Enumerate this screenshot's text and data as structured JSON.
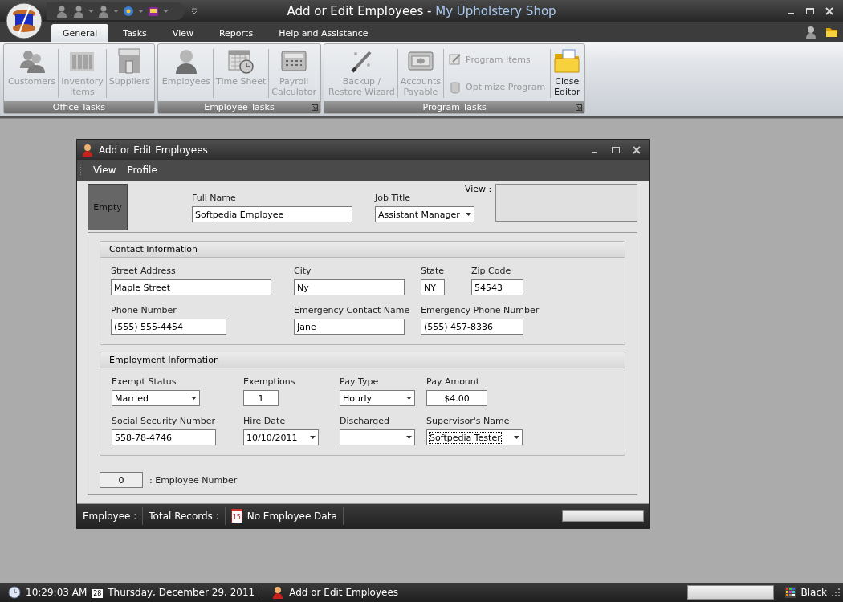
{
  "app": {
    "title": "Add or Edit Employees -",
    "app_name": "My Upholstery Shop"
  },
  "tabs": [
    {
      "label": "General",
      "selected": true
    },
    {
      "label": "Tasks",
      "selected": false
    },
    {
      "label": "View",
      "selected": false
    },
    {
      "label": "Reports",
      "selected": false
    },
    {
      "label": "Help and Assistance",
      "selected": false
    }
  ],
  "ribbon": {
    "groups": [
      {
        "label": "Office Tasks",
        "has_launcher": false,
        "items": [
          {
            "kind": "large",
            "label": "Customers",
            "disabled": true
          },
          {
            "kind": "large",
            "label": "Inventory\nItems",
            "disabled": true
          },
          {
            "kind": "large",
            "label": "Suppliers",
            "disabled": true
          }
        ]
      },
      {
        "label": "Employee Tasks",
        "has_launcher": true,
        "items": [
          {
            "kind": "large",
            "label": "Employees",
            "disabled": true
          },
          {
            "kind": "large",
            "label": "Time Sheet",
            "disabled": true
          },
          {
            "kind": "large",
            "label": "Payroll\nCalculator",
            "disabled": true
          }
        ]
      },
      {
        "label": "Program Tasks",
        "has_launcher": true,
        "items": [
          {
            "kind": "large",
            "label": "Backup /\nRestore Wizard",
            "disabled": true
          },
          {
            "kind": "large",
            "label": "Accounts\nPayable",
            "disabled": true
          },
          {
            "kind": "small",
            "label": "Program Items",
            "disabled": true
          },
          {
            "kind": "small",
            "label": "Optimize Program",
            "disabled": true
          },
          {
            "kind": "large",
            "label": "Close\nEditor",
            "disabled": false
          }
        ]
      }
    ]
  },
  "dialog": {
    "title": "Add or Edit Employees",
    "menu": [
      "View",
      "Profile"
    ],
    "photo_text": "Empty",
    "full_name": {
      "label": "Full Name",
      "value": "Softpedia Employee"
    },
    "job_title": {
      "label": "Job Title",
      "value": "Assistant Manager"
    },
    "view_label": "View :",
    "sections": [
      {
        "title": "Contact Information",
        "fields": [
          {
            "label": "Street Address",
            "value": "Maple Street",
            "kind": "text",
            "focused": false
          },
          {
            "label": "City",
            "value": "Ny",
            "kind": "text",
            "focused": false
          },
          {
            "label": "State",
            "value": "NY",
            "kind": "text",
            "focused": false
          },
          {
            "label": "Zip Code",
            "value": "54543",
            "kind": "text",
            "focused": false
          },
          {
            "label": "Phone Number",
            "value": "(555) 555-4454",
            "kind": "text",
            "focused": false
          },
          {
            "label": "Emergency Contact Name",
            "value": "Jane",
            "kind": "text",
            "focused": false
          },
          {
            "label": "Emergency Phone Number",
            "value": "(555) 457-8336",
            "kind": "text",
            "focused": false
          }
        ]
      },
      {
        "title": "Employment Information",
        "fields": [
          {
            "label": "Exempt Status",
            "value": "Married",
            "kind": "dropdown",
            "focused": false
          },
          {
            "label": "Exemptions",
            "value": "1",
            "kind": "number",
            "focused": false
          },
          {
            "label": "Pay Type",
            "value": "Hourly",
            "kind": "dropdown",
            "focused": false
          },
          {
            "label": "Pay Amount",
            "value": "$4.00",
            "kind": "number",
            "focused": false
          },
          {
            "label": "Social Security Number",
            "value": "558-78-4746",
            "kind": "text",
            "focused": false
          },
          {
            "label": "Hire Date",
            "value": "10/10/2011",
            "kind": "dropdown",
            "focused": false
          },
          {
            "label": "Discharged",
            "kind": "dropdown",
            "focused": false
          },
          {
            "label": "Supervisor's Name",
            "value": "Softpedia Tester",
            "kind": "dropdown",
            "focused": true
          }
        ]
      }
    ],
    "employee_number": {
      "value": "0",
      "label": ": Employee Number"
    },
    "status": {
      "employee": "Employee :",
      "total_records": "Total Records :",
      "icon_day": "15",
      "message": "No Employee Data"
    }
  },
  "taskbar": {
    "time": "10:29:03 AM",
    "calendar_day": "28",
    "date": "Thursday, December 29, 2011",
    "window": "Add or Edit Employees",
    "theme": "Black"
  }
}
